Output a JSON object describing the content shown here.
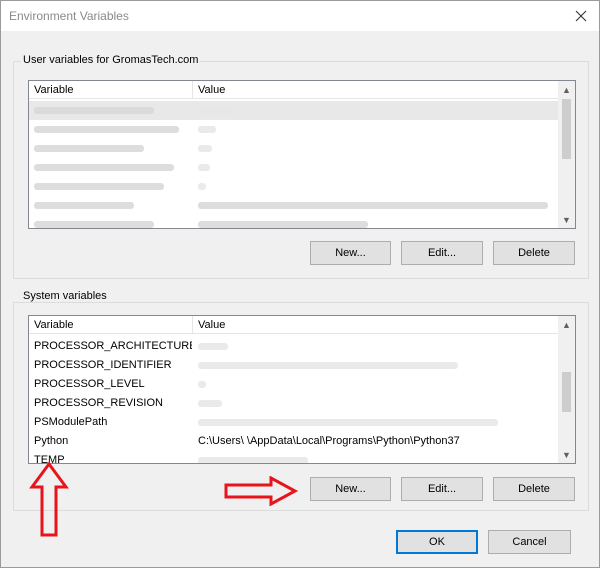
{
  "window": {
    "title": "Environment Variables"
  },
  "user_group": {
    "label": "User variables for GromasTech.com",
    "columns": [
      "Variable",
      "Value"
    ],
    "rows": [
      {
        "variable": "",
        "value": ""
      },
      {
        "variable": "",
        "value": ""
      },
      {
        "variable": "",
        "value": ""
      },
      {
        "variable": "",
        "value": ""
      },
      {
        "variable": "",
        "value": ""
      },
      {
        "variable": "",
        "value": ""
      },
      {
        "variable": "",
        "value": ""
      }
    ],
    "buttons": {
      "new": "New...",
      "edit": "Edit...",
      "delete": "Delete"
    }
  },
  "system_group": {
    "label": "System variables",
    "columns": [
      "Variable",
      "Value"
    ],
    "rows": [
      {
        "variable": "PROCESSOR_ARCHITECTURE",
        "value": ""
      },
      {
        "variable": "PROCESSOR_IDENTIFIER",
        "value": ""
      },
      {
        "variable": "PROCESSOR_LEVEL",
        "value": ""
      },
      {
        "variable": "PROCESSOR_REVISION",
        "value": ""
      },
      {
        "variable": "PSModulePath",
        "value": ""
      },
      {
        "variable": "Python",
        "value": "C:\\Users\\       \\AppData\\Local\\Programs\\Python\\Python37"
      },
      {
        "variable": "TEMP",
        "value": ""
      }
    ],
    "buttons": {
      "new": "New...",
      "edit": "Edit...",
      "delete": "Delete"
    }
  },
  "footer": {
    "ok": "OK",
    "cancel": "Cancel"
  },
  "annotation": {
    "arrow_color": "#e8141b"
  }
}
